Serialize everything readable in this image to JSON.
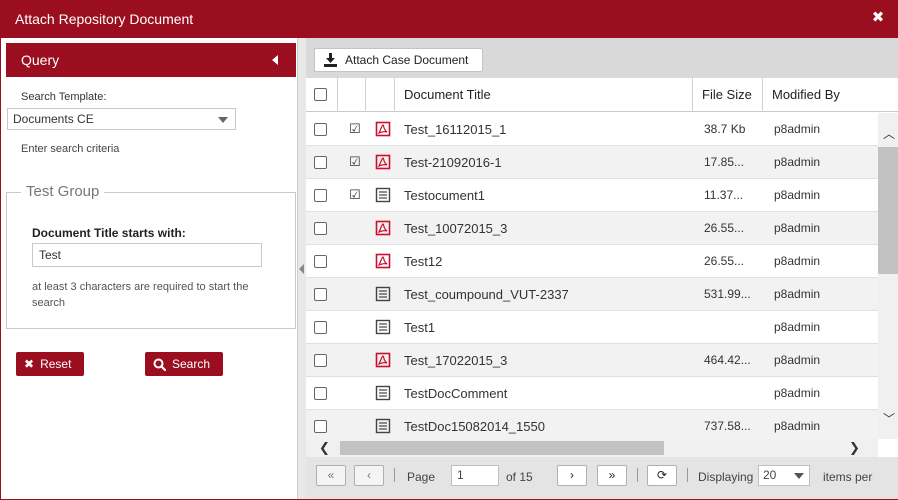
{
  "dialog": {
    "title": "Attach Repository Document",
    "close_glyph": "✖"
  },
  "query": {
    "header": "Query",
    "template_label": "Search Template:",
    "template_value": "Documents CE",
    "criteria_hint": "Enter search criteria",
    "group_title": "Test Group",
    "field_label": "Document Title starts with:",
    "field_value": "Test",
    "field_hint": "at least 3 characters are required to start the search",
    "reset_label": "Reset",
    "search_label": "Search"
  },
  "toolbar": {
    "attach_label": "Attach Case Document"
  },
  "grid": {
    "columns": {
      "title": "Document Title",
      "size": "File Size",
      "modified": "Modified By"
    },
    "rows": [
      {
        "title": "Test_16112015_1",
        "size": "38.7 Kb",
        "modified_by": "p8admin",
        "checked_out": "☑",
        "icon": "pdf-icon"
      },
      {
        "title": "Test-21092016-1",
        "size": "17.85...",
        "modified_by": "p8admin",
        "checked_out": "☑",
        "icon": "pdf-icon"
      },
      {
        "title": "Testocument1",
        "size": "11.37...",
        "modified_by": "p8admin",
        "checked_out": "☑",
        "icon": "text-doc-icon"
      },
      {
        "title": "Test_10072015_3",
        "size": "26.55...",
        "modified_by": "p8admin",
        "checked_out": "",
        "icon": "pdf-icon"
      },
      {
        "title": "Test12",
        "size": "26.55...",
        "modified_by": "p8admin",
        "checked_out": "",
        "icon": "pdf-icon"
      },
      {
        "title": "Test_coumpound_VUT-2337",
        "size": "531.99...",
        "modified_by": "p8admin",
        "checked_out": "",
        "icon": "text-doc-icon"
      },
      {
        "title": "Test1",
        "size": "",
        "modified_by": "p8admin",
        "checked_out": "",
        "icon": "text-doc-icon"
      },
      {
        "title": "Test_17022015_3",
        "size": "464.42...",
        "modified_by": "p8admin",
        "checked_out": "",
        "icon": "pdf-icon"
      },
      {
        "title": "TestDocComment",
        "size": "",
        "modified_by": "p8admin",
        "checked_out": "",
        "icon": "text-doc-icon"
      },
      {
        "title": "TestDoc15082014_1550",
        "size": "737.58...",
        "modified_by": "p8admin",
        "checked_out": "",
        "icon": "text-doc-icon"
      }
    ]
  },
  "pager": {
    "page_label": "Page",
    "page_value": "1",
    "of_label": "of 15",
    "displaying_label": "Displaying",
    "page_size": "20",
    "items_label": "items per"
  },
  "colors": {
    "accent": "#9b0e1f",
    "pdf": "#c8102e"
  }
}
